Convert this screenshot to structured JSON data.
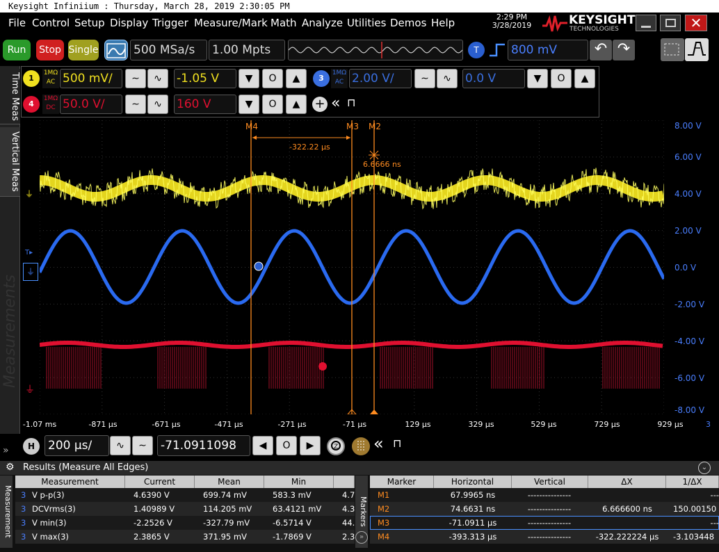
{
  "window": {
    "title": "Keysight Infiniium : Thursday, March 28, 2019 2:30:05 PM"
  },
  "menu": [
    "File",
    "Control",
    "Setup",
    "Display",
    "Trigger",
    "Measure/Mark",
    "Math",
    "Analyze",
    "Utilities",
    "Demos",
    "Help"
  ],
  "clock": {
    "time": "2:29 PM",
    "date": "3/28/2019"
  },
  "brand": {
    "name": "KEYSIGHT",
    "sub": "TECHNOLOGIES"
  },
  "toolbar": {
    "run": "Run",
    "stop": "Stop",
    "single": "Single",
    "sample_rate": "500 MSa/s",
    "memory_depth": "1.00 Mpts",
    "trigger_source": "T",
    "trigger_level": "800 mV"
  },
  "channels": {
    "ch1": {
      "num": "1",
      "coupling1": "1MΩ",
      "coupling2": "AC",
      "scale": "500 mV/",
      "offset": "-1.05 V",
      "color": "#f0e020"
    },
    "ch3": {
      "num": "3",
      "coupling1": "1MΩ",
      "coupling2": "AC",
      "scale": "2.00 V/",
      "offset": "0.0 V",
      "color": "#3a6fe0"
    },
    "ch4": {
      "num": "4",
      "coupling1": "1MΩ",
      "coupling2": "DC",
      "scale": "50.0 V/",
      "offset": "160 V",
      "color": "#e01030"
    }
  },
  "side_tabs": [
    "Time Meas",
    "Vertical Meas"
  ],
  "watermark": "Measurements",
  "markers_overlay": {
    "m4_label": "M4",
    "m3_label": "M3",
    "m2_label": "M2",
    "delta_time": "-322.22 µs",
    "delta_m2": "6.6666 ns"
  },
  "right_axis": [
    "8.00 V",
    "6.00 V",
    "4.00 V",
    "2.00 V",
    "0.0 V",
    "-2.00 V",
    "-4.00 V",
    "-6.00 V",
    "-8.00 V"
  ],
  "x_axis": [
    "-1.07 ms",
    "-871 µs",
    "-671 µs",
    "-471 µs",
    "-271 µs",
    "-71 µs",
    "129 µs",
    "329 µs",
    "529 µs",
    "729 µs",
    "929 µs"
  ],
  "x_axis_edge": "3",
  "horizontal": {
    "badge": "H",
    "scale": "200 µs/",
    "position": "-71.0911098 µs"
  },
  "results": {
    "title": "Results (Measure All Edges)",
    "meas_headers": [
      "Measurement",
      "Current",
      "Mean",
      "Min",
      ""
    ],
    "meas_rows": [
      {
        "idx": "3",
        "name": "V p-p(3)",
        "current": "4.6390 V",
        "mean": "699.74 mV",
        "min": "583.3 mV",
        "max": "4.7"
      },
      {
        "idx": "3",
        "name": "DCVrms(3)",
        "current": "1.40989 V",
        "mean": "114.205 mV",
        "min": "63.4121 mV",
        "max": "4.3"
      },
      {
        "idx": "3",
        "name": "V min(3)",
        "current": "-2.2526 V",
        "mean": "-327.79 mV",
        "min": "-6.5714 V",
        "max": "44."
      },
      {
        "idx": "3",
        "name": "V max(3)",
        "current": "2.3865 V",
        "mean": "371.95 mV",
        "min": "-1.7869 V",
        "max": "2.3"
      }
    ],
    "side_label_left": "Measurement",
    "side_label_mid": "Markers",
    "marker_headers": [
      "Marker",
      "Horizontal",
      "Vertical",
      "ΔX",
      "1/ΔX"
    ],
    "marker_rows": [
      {
        "name": "M1",
        "h": "67.9965 ns",
        "v": "---------------",
        "dx": "",
        "inv": "---"
      },
      {
        "name": "M2",
        "h": "74.6631 ns",
        "v": "---------------",
        "dx": "6.666600 ns",
        "inv": "150.00150"
      },
      {
        "name": "M3",
        "h": "-71.0911 µs",
        "v": "---------------",
        "dx": "",
        "inv": "---"
      },
      {
        "name": "M4",
        "h": "-393.313 µs",
        "v": "---------------",
        "dx": "-322.222224 µs",
        "inv": "-3.103448"
      }
    ]
  },
  "colors": {
    "accent_blue": "#2a5fd0",
    "marker_orange": "#ff8c20",
    "panel_bg": "#111111"
  }
}
